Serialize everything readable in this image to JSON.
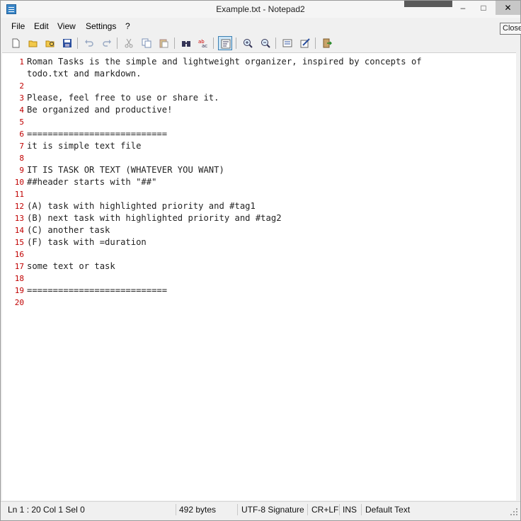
{
  "window": {
    "title": "Example.txt - Notepad2"
  },
  "titlebar_buttons": {
    "minimize": "–",
    "maximize": "□",
    "close": "✕"
  },
  "tooltip": "Close",
  "menu": [
    {
      "label": "File"
    },
    {
      "label": "Edit"
    },
    {
      "label": "View"
    },
    {
      "label": "Settings"
    },
    {
      "label": "?"
    }
  ],
  "toolbar": {
    "icons": [
      "new-file-icon",
      "open-file-icon",
      "browse-icon",
      "save-icon",
      "undo-icon",
      "redo-icon",
      "cut-icon",
      "copy-icon",
      "paste-icon",
      "find-icon",
      "replace-icon",
      "word-wrap-icon",
      "zoom-in-icon",
      "zoom-out-icon",
      "scheme-icon",
      "customize-scheme-icon",
      "exit-icon"
    ]
  },
  "editor": {
    "lines": [
      {
        "num": "1",
        "text": "Roman Tasks is the simple and lightweight organizer, inspired by concepts of"
      },
      {
        "num": "",
        "text": "todo.txt and markdown."
      },
      {
        "num": "2",
        "text": ""
      },
      {
        "num": "3",
        "text": "Please, feel free to use or share it."
      },
      {
        "num": "4",
        "text": "Be organized and productive!"
      },
      {
        "num": "5",
        "text": ""
      },
      {
        "num": "6",
        "text": "==========================="
      },
      {
        "num": "7",
        "text": "it is simple text file"
      },
      {
        "num": "8",
        "text": ""
      },
      {
        "num": "9",
        "text": "IT IS TASK OR TEXT (WHATEVER YOU WANT)"
      },
      {
        "num": "10",
        "text": "##header starts with \"##\""
      },
      {
        "num": "11",
        "text": ""
      },
      {
        "num": "12",
        "text": "(A) task with highlighted priority and #tag1"
      },
      {
        "num": "13",
        "text": "(B) next task with highlighted priority and #tag2"
      },
      {
        "num": "14",
        "text": "(C) another task"
      },
      {
        "num": "15",
        "text": "(F) task with =duration"
      },
      {
        "num": "16",
        "text": ""
      },
      {
        "num": "17",
        "text": "some text or task"
      },
      {
        "num": "18",
        "text": ""
      },
      {
        "num": "19",
        "text": "==========================="
      },
      {
        "num": "20",
        "text": ""
      }
    ]
  },
  "status": {
    "position": "Ln 1 : 20   Col 1   Sel 0",
    "size": "492 bytes",
    "encoding": "UTF-8 Signature",
    "line_endings": "CR+LF",
    "mode": "INS",
    "lexer": "Default Text"
  },
  "colors": {
    "line_number": "#c00000",
    "accent": "#3c7fb1"
  }
}
